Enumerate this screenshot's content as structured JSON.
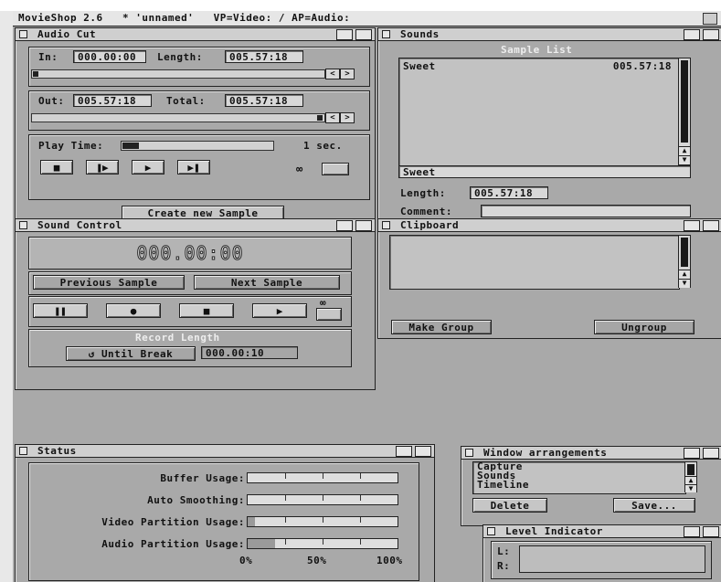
{
  "titlebar": {
    "text": "MovieShop 2.6   * 'unnamed'   VP=Video: / AP=Audio:"
  },
  "audio_cut": {
    "title": "Audio Cut",
    "in_label": "In:",
    "in_value": "000.00:00",
    "length_label": "Length:",
    "length_value": "005.57:18",
    "out_label": "Out:",
    "out_value": "005.57:18",
    "total_label": "Total:",
    "total_value": "005.57:18",
    "play_time_label": "Play Time:",
    "play_time_value": "1 sec.",
    "create_button": "Create new Sample",
    "left_arrow": "<",
    "right_arrow": ">"
  },
  "sounds": {
    "title": "Sounds",
    "list_title": "Sample List",
    "items": [
      {
        "name": "Sweet",
        "length": "005.57:18"
      }
    ],
    "name_value": "Sweet",
    "length_label": "Length:",
    "length_value": "005.57:18",
    "comment_label": "Comment:",
    "comment_value": ""
  },
  "sound_control": {
    "title": "Sound Control",
    "counter": "000.00:00",
    "prev_button": "Previous Sample",
    "next_button": "Next Sample",
    "record_length_label": "Record Length",
    "until_break": "Until Break",
    "record_time": "000.00:10"
  },
  "clipboard": {
    "title": "Clipboard",
    "make_group": "Make Group",
    "ungroup": "Ungroup"
  },
  "status": {
    "title": "Status",
    "rows": [
      {
        "label": "Buffer Usage:",
        "level": 0
      },
      {
        "label": "Auto Smoothing:",
        "level": 0
      },
      {
        "label": "Video Partition Usage:",
        "level": 0.05
      },
      {
        "label": "Audio Partition Usage:",
        "level": 0.18
      }
    ],
    "scale": [
      "0%",
      "50%",
      "100%"
    ]
  },
  "window_arrangements": {
    "title": "Window arrangements",
    "items": [
      "Capture",
      "Sounds",
      "Timeline"
    ],
    "delete_button": "Delete",
    "save_button": "Save..."
  },
  "level_indicator": {
    "title": "Level Indicator",
    "left_label": "L:",
    "right_label": "R:"
  }
}
